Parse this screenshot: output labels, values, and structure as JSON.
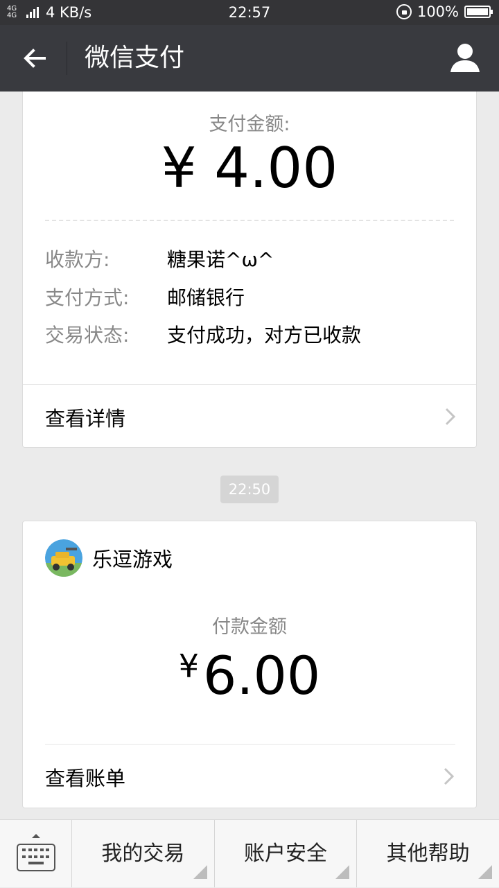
{
  "status_bar": {
    "network": "4G 4G",
    "speed": "4 KB/s",
    "time": "22:57",
    "battery": "100%"
  },
  "nav": {
    "title": "微信支付"
  },
  "payment1": {
    "amount_label": "支付金额:",
    "amount": "¥ 4.00",
    "rows": [
      {
        "key": "收款方:",
        "value": "糖果诺^ω^"
      },
      {
        "key": "支付方式:",
        "value": "邮储银行"
      },
      {
        "key": "交易状态:",
        "value": "支付成功，对方已收款"
      }
    ],
    "detail_link": "查看详情"
  },
  "timestamp": "22:50",
  "payment2": {
    "merchant": "乐逗游戏",
    "amount_label": "付款金额",
    "currency": "¥",
    "amount": "6.00",
    "bill_link": "查看账单"
  },
  "bottom_menu": {
    "items": [
      "我的交易",
      "账户安全",
      "其他帮助"
    ]
  },
  "colors": {
    "nav_bg": "#393a3f",
    "status_bg": "#343437",
    "page_bg": "#ebebeb"
  }
}
